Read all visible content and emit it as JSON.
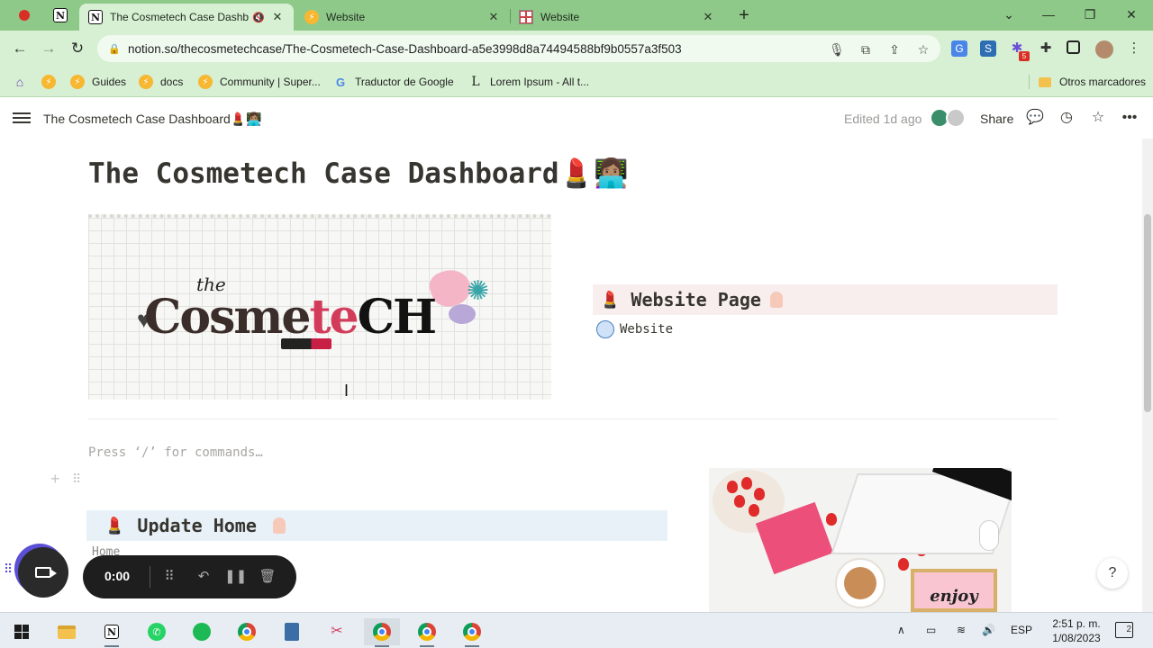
{
  "browser": {
    "tabs": [
      {
        "title": "The Cosmetech Case Dashbo",
        "active": true
      },
      {
        "title": "Website",
        "active": false
      },
      {
        "title": "Website",
        "active": false
      }
    ],
    "url": "notion.so/thecosmetechcase/The-Cosmetech-Case-Dashboard-a5e3998d8a74494588bf9b0557a3f503",
    "bookmarks": [
      "Guides",
      "docs",
      "Community | Super...",
      "Traductor de Google",
      "Lorem Ipsum - All t...",
      "Otros marcadores"
    ],
    "extension_badge": "5"
  },
  "notion": {
    "breadcrumb": "The Cosmetech Case Dashboard💄👩🏽‍💻",
    "edited": "Edited 1d ago",
    "share_label": "Share",
    "page_title": "The Cosmetech Case Dashboard💄👩🏽‍💻",
    "banner_text_the": "the",
    "banner_text_main_a": "Cosme",
    "banner_text_main_b": "te",
    "banner_text_main_c": "CH",
    "website_block": {
      "emoji": "💄",
      "label": "Website Page",
      "link": "Website"
    },
    "placeholder": "Press ‘/’ for commands…",
    "update_block": {
      "emoji": "💄",
      "label": "Update Home",
      "link": "Home"
    },
    "photo_sign": "enjoy",
    "help_label": "?"
  },
  "recorder": {
    "time": "0:00"
  },
  "taskbar": {
    "language": "ESP",
    "time": "2:51 p. m.",
    "date": "1/08/2023",
    "notification_count": "2"
  },
  "colors": {
    "chrome_tabstrip": "#8fc98a",
    "chrome_toolbar": "#d7f0d3",
    "website_block_bg": "#f8eeee",
    "update_block_bg": "#e7f1f7",
    "recorder_accent": "#5b4fd6"
  }
}
